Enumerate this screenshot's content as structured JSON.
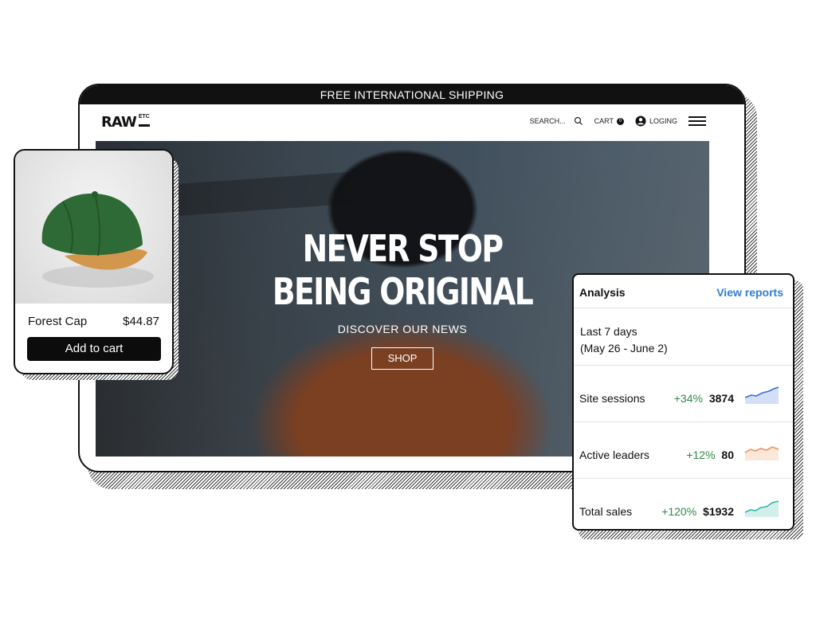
{
  "storefront": {
    "promo_bar": "FREE INTERNATIONAL SHIPPING",
    "logo": {
      "main": "RAW",
      "sub": "ETC"
    },
    "nav": {
      "search": "SEARCH...",
      "search_icon": "search-icon",
      "cart": "CART",
      "cart_count": "0",
      "login": "LOGING",
      "user_icon": "user-icon",
      "menu_icon": "hamburger-menu-icon"
    },
    "hero": {
      "title_line1": "NEVER STOP",
      "title_line2": "BEING ORIGINAL",
      "subtitle": "DISCOVER OUR NEWS",
      "cta": "SHOP"
    }
  },
  "product_card": {
    "name": "Forest Cap",
    "price": "$44.87",
    "button": "Add to cart",
    "colors": {
      "crown": "#2e6a35",
      "brim": "#d2974c"
    }
  },
  "analysis": {
    "title": "Analysis",
    "link": "View reports",
    "period_line1": "Last 7 days",
    "period_line2": "(May 26 - June 2)",
    "metrics": [
      {
        "label": "Site sessions",
        "change": "+34%",
        "value": "3874",
        "color": "#3b6fd8"
      },
      {
        "label": "Active leaders",
        "change": "+12%",
        "value": "80",
        "color": "#f0935a"
      },
      {
        "label": "Total sales",
        "change": "+120%",
        "value": "$1932",
        "color": "#35b7a8"
      }
    ]
  }
}
